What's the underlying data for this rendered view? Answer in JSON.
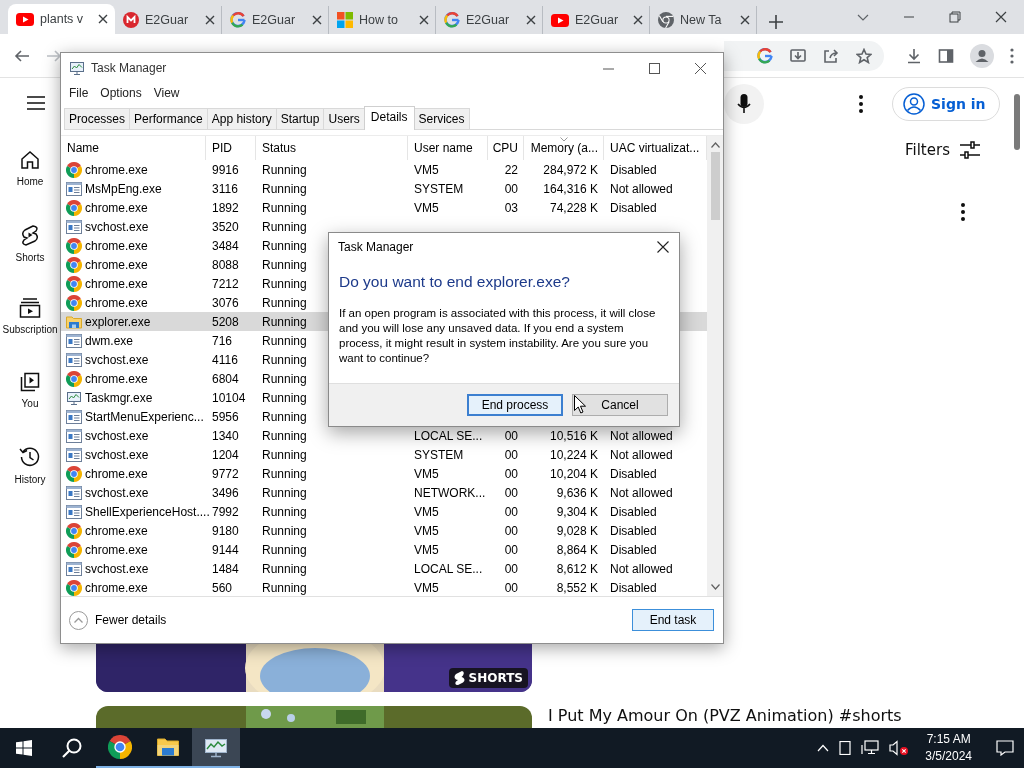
{
  "browser": {
    "tabs": [
      {
        "title": "plants v",
        "kind": "youtube",
        "selected": true
      },
      {
        "title": "E2Guar",
        "kind": "mega",
        "selected": false
      },
      {
        "title": "E2Guar",
        "kind": "google",
        "selected": false
      },
      {
        "title": "How to",
        "kind": "windows",
        "selected": false
      },
      {
        "title": "E2Guar",
        "kind": "google",
        "selected": false
      },
      {
        "title": "E2Guar",
        "kind": "youtube",
        "selected": false
      },
      {
        "title": "New Ta",
        "kind": "chrome",
        "selected": false
      }
    ]
  },
  "youtube": {
    "sidebar": [
      {
        "label": "Home",
        "kind": "home"
      },
      {
        "label": "Shorts",
        "kind": "shorts"
      },
      {
        "label": "Subscription",
        "kind": "subscriptions"
      },
      {
        "label": "You",
        "kind": "you"
      },
      {
        "label": "History",
        "kind": "history"
      }
    ],
    "sign_in": "Sign in",
    "filters": "Filters",
    "shorts_badge": "SHORTS",
    "video_title": "I Put My Amour On (PVZ Animation) #shorts"
  },
  "task_manager": {
    "title": "Task Manager",
    "menu": [
      "File",
      "Options",
      "View"
    ],
    "tabs": [
      {
        "label": "Processes",
        "selected": false
      },
      {
        "label": "Performance",
        "selected": false
      },
      {
        "label": "App history",
        "selected": false
      },
      {
        "label": "Startup",
        "selected": false
      },
      {
        "label": "Users",
        "selected": false
      },
      {
        "label": "Details",
        "selected": true
      },
      {
        "label": "Services",
        "selected": false
      }
    ],
    "columns": [
      {
        "label": "Name",
        "sorted": false
      },
      {
        "label": "PID",
        "sorted": false
      },
      {
        "label": "Status",
        "sorted": false
      },
      {
        "label": "User name",
        "sorted": false
      },
      {
        "label": "CPU",
        "sorted": false
      },
      {
        "label": "Memory (a...",
        "sorted": true
      },
      {
        "label": "UAC virtualizat...",
        "sorted": false
      }
    ],
    "rows": [
      {
        "kind": "chrome",
        "name": "chrome.exe",
        "pid": "9916",
        "status": "Running",
        "user": "VM5",
        "cpu": "22",
        "memory": "284,972 K",
        "uac": "Disabled",
        "selected": false
      },
      {
        "kind": "service",
        "name": "MsMpEng.exe",
        "pid": "3116",
        "status": "Running",
        "user": "SYSTEM",
        "cpu": "00",
        "memory": "164,316 K",
        "uac": "Not allowed",
        "selected": false
      },
      {
        "kind": "chrome",
        "name": "chrome.exe",
        "pid": "1892",
        "status": "Running",
        "user": "VM5",
        "cpu": "03",
        "memory": "74,228 K",
        "uac": "Disabled",
        "selected": false
      },
      {
        "kind": "service",
        "name": "svchost.exe",
        "pid": "3520",
        "status": "Running",
        "selected": false
      },
      {
        "kind": "chrome",
        "name": "chrome.exe",
        "pid": "3484",
        "status": "Running",
        "selected": false
      },
      {
        "kind": "chrome",
        "name": "chrome.exe",
        "pid": "8088",
        "status": "Running",
        "selected": false
      },
      {
        "kind": "chrome",
        "name": "chrome.exe",
        "pid": "7212",
        "status": "Running",
        "selected": false
      },
      {
        "kind": "chrome",
        "name": "chrome.exe",
        "pid": "3076",
        "status": "Running",
        "selected": false
      },
      {
        "kind": "explorer",
        "name": "explorer.exe",
        "pid": "5208",
        "status": "Running",
        "selected": true
      },
      {
        "kind": "service",
        "name": "dwm.exe",
        "pid": "716",
        "status": "Running",
        "selected": false
      },
      {
        "kind": "service",
        "name": "svchost.exe",
        "pid": "4116",
        "status": "Running",
        "selected": false
      },
      {
        "kind": "chrome",
        "name": "chrome.exe",
        "pid": "6804",
        "status": "Running",
        "selected": false
      },
      {
        "kind": "taskmgr",
        "name": "Taskmgr.exe",
        "pid": "10104",
        "status": "Running",
        "selected": false
      },
      {
        "kind": "service",
        "name": "StartMenuExperienc...",
        "pid": "5956",
        "status": "Running",
        "selected": false
      },
      {
        "kind": "service",
        "name": "svchost.exe",
        "pid": "1340",
        "status": "Running",
        "user": "LOCAL SE...",
        "cpu": "00",
        "memory": "10,516 K",
        "uac": "Not allowed",
        "selected": false
      },
      {
        "kind": "service",
        "name": "svchost.exe",
        "pid": "1204",
        "status": "Running",
        "user": "SYSTEM",
        "cpu": "00",
        "memory": "10,224 K",
        "uac": "Not allowed",
        "selected": false
      },
      {
        "kind": "chrome",
        "name": "chrome.exe",
        "pid": "9772",
        "status": "Running",
        "user": "VM5",
        "cpu": "00",
        "memory": "10,204 K",
        "uac": "Disabled",
        "selected": false
      },
      {
        "kind": "service",
        "name": "svchost.exe",
        "pid": "3496",
        "status": "Running",
        "user": "NETWORK...",
        "cpu": "00",
        "memory": "9,636 K",
        "uac": "Not allowed",
        "selected": false
      },
      {
        "kind": "service",
        "name": "ShellExperienceHost....",
        "pid": "7992",
        "status": "Running",
        "user": "VM5",
        "cpu": "00",
        "memory": "9,304 K",
        "uac": "Disabled",
        "selected": false
      },
      {
        "kind": "chrome",
        "name": "chrome.exe",
        "pid": "9180",
        "status": "Running",
        "user": "VM5",
        "cpu": "00",
        "memory": "9,028 K",
        "uac": "Disabled",
        "selected": false
      },
      {
        "kind": "chrome",
        "name": "chrome.exe",
        "pid": "9144",
        "status": "Running",
        "user": "VM5",
        "cpu": "00",
        "memory": "8,864 K",
        "uac": "Disabled",
        "selected": false
      },
      {
        "kind": "service",
        "name": "svchost.exe",
        "pid": "1484",
        "status": "Running",
        "user": "LOCAL SE...",
        "cpu": "00",
        "memory": "8,612 K",
        "uac": "Not allowed",
        "selected": false
      },
      {
        "kind": "chrome",
        "name": "chrome.exe",
        "pid": "560",
        "status": "Running",
        "user": "VM5",
        "cpu": "00",
        "memory": "8,552 K",
        "uac": "Disabled",
        "selected": false
      }
    ],
    "details_toggle": "Fewer details",
    "end_task": "End task"
  },
  "dialog": {
    "title": "Task Manager",
    "heading": "Do you want to end explorer.exe?",
    "message": "If an open program is associated with this process, it will close and you will lose any unsaved data. If you end a system process, it might result in system instability. Are you sure you want to continue?",
    "buttons": [
      {
        "label": "End process",
        "default": true
      },
      {
        "label": "Cancel",
        "default": false
      }
    ]
  },
  "taskbar": {
    "apps": [
      {
        "kind": "chrome",
        "selected": false
      },
      {
        "kind": "explorer",
        "selected": false
      },
      {
        "kind": "taskmgr",
        "selected": true
      }
    ],
    "time": "7:15 AM",
    "date": "3/5/2024"
  }
}
